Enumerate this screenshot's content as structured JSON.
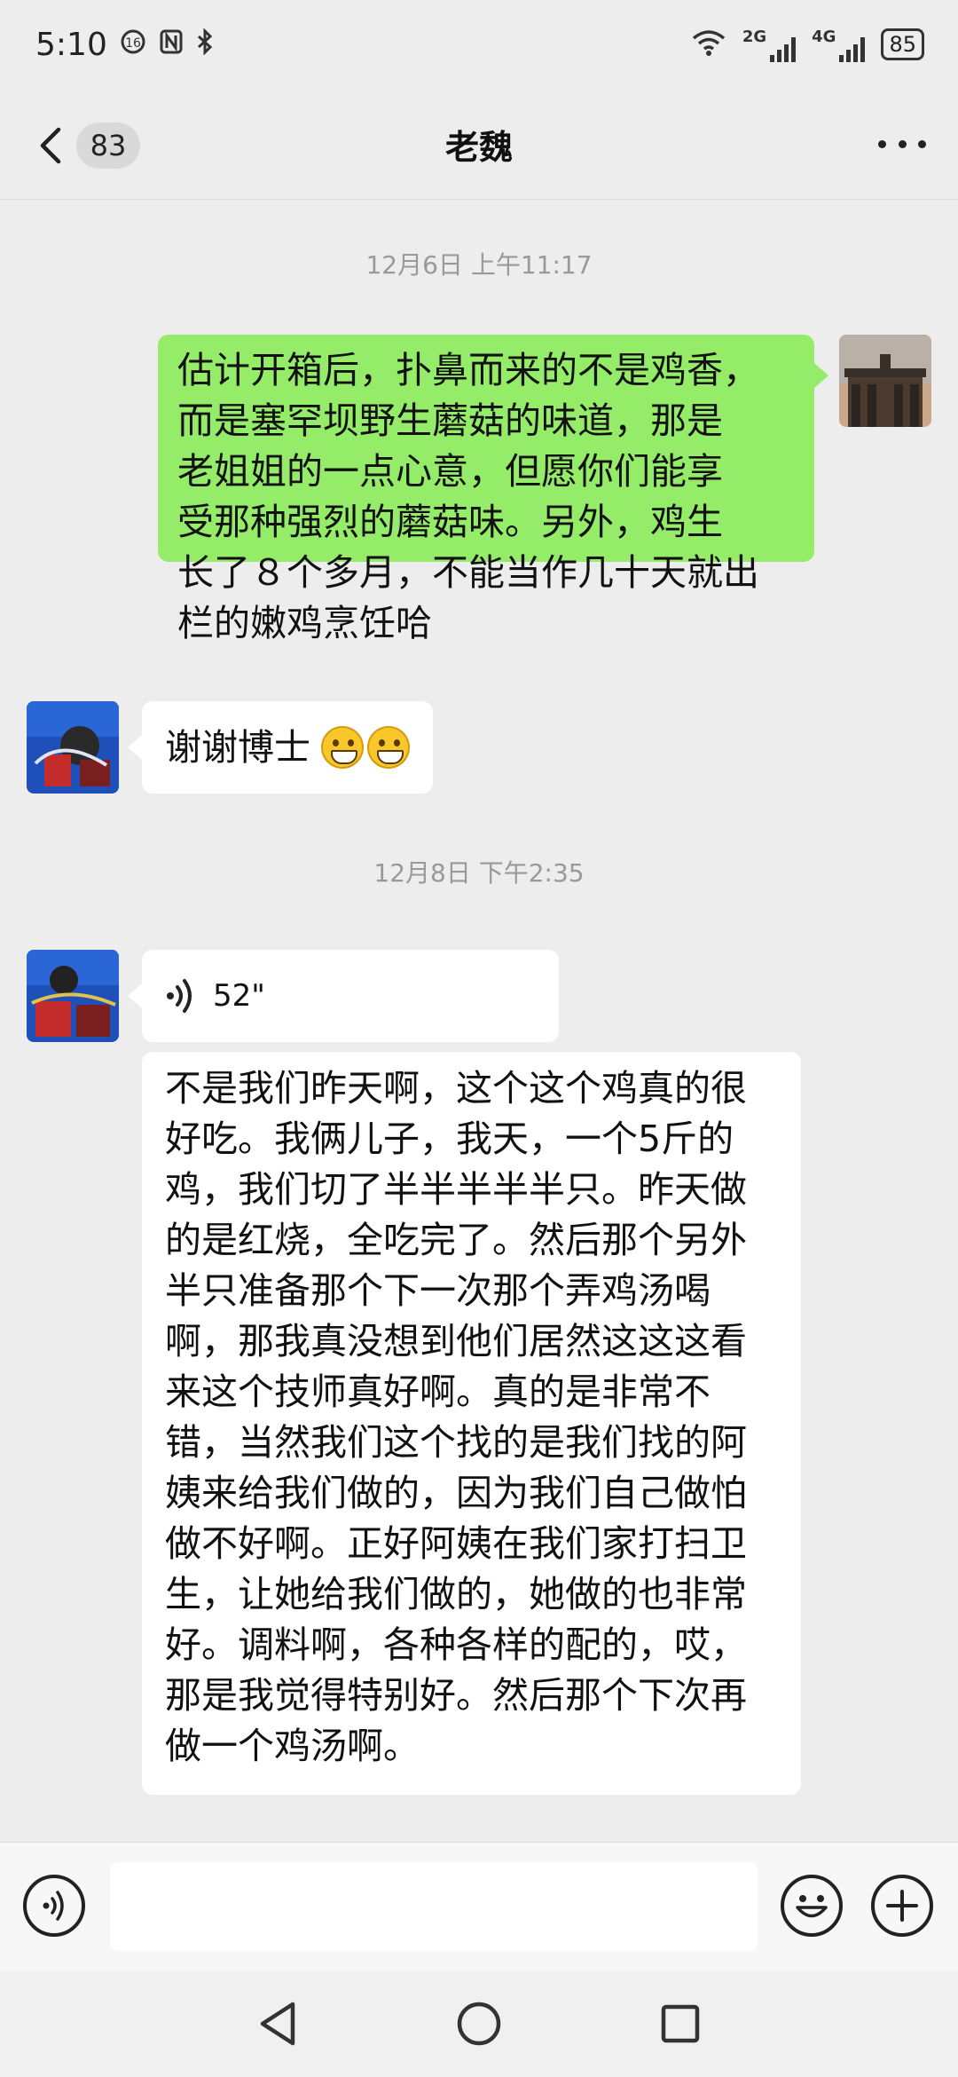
{
  "status_bar": {
    "time": "5:10",
    "network_labels": [
      "2G",
      "4G"
    ],
    "battery": "85"
  },
  "header": {
    "unread_count": "83",
    "title": "老魏"
  },
  "messages": [
    {
      "kind": "timestamp",
      "text": "12月6日 上午11:17"
    },
    {
      "kind": "text",
      "direction": "sent",
      "lines": [
        "估计开箱后，扑鼻而来的不是鸡香，",
        "而是塞罕坝野生蘑菇的味道，那是",
        "老姐姐的一点心意，但愿你们能享",
        "受那种强烈的蘑菇味。另外，鸡生",
        "长了８个多月，不能当作几十天就出",
        "栏的嫩鸡烹饪哈"
      ]
    },
    {
      "kind": "text",
      "direction": "received",
      "text": "谢谢博士",
      "emoji": [
        "grin-emoji",
        "grin-emoji"
      ]
    },
    {
      "kind": "timestamp",
      "text": "12月8日 下午2:35"
    },
    {
      "kind": "voice",
      "direction": "received",
      "duration": "52\""
    },
    {
      "kind": "text",
      "direction": "received",
      "lines": [
        "不是我们昨天啊，这个这个鸡真的很",
        "好吃。我俩儿子，我天，一个5斤的",
        "鸡，我们切了半半半半半只。昨天做",
        "的是红烧，全吃完了。然后那个另外",
        "半只准备那个下一次那个弄鸡汤喝",
        "啊，那我真没想到他们居然这这这看",
        "来这个技师真好啊。真的是非常不",
        "错，当然我们这个找的是我们找的阿",
        "姨来给我们做的，因为我们自己做怕",
        "做不好啊。正好阿姨在我们家打扫卫",
        "生，让她给我们做的，她做的也非常",
        "好。调料啊，各种各样的配的，哎，",
        "那是我觉得特别好。然后那个下次再",
        "做一个鸡汤啊。"
      ]
    }
  ],
  "input": {
    "value": "",
    "placeholder": ""
  },
  "colors": {
    "sent_bubble": "#95ec69",
    "received_bubble": "#ffffff",
    "background": "#ededed"
  }
}
